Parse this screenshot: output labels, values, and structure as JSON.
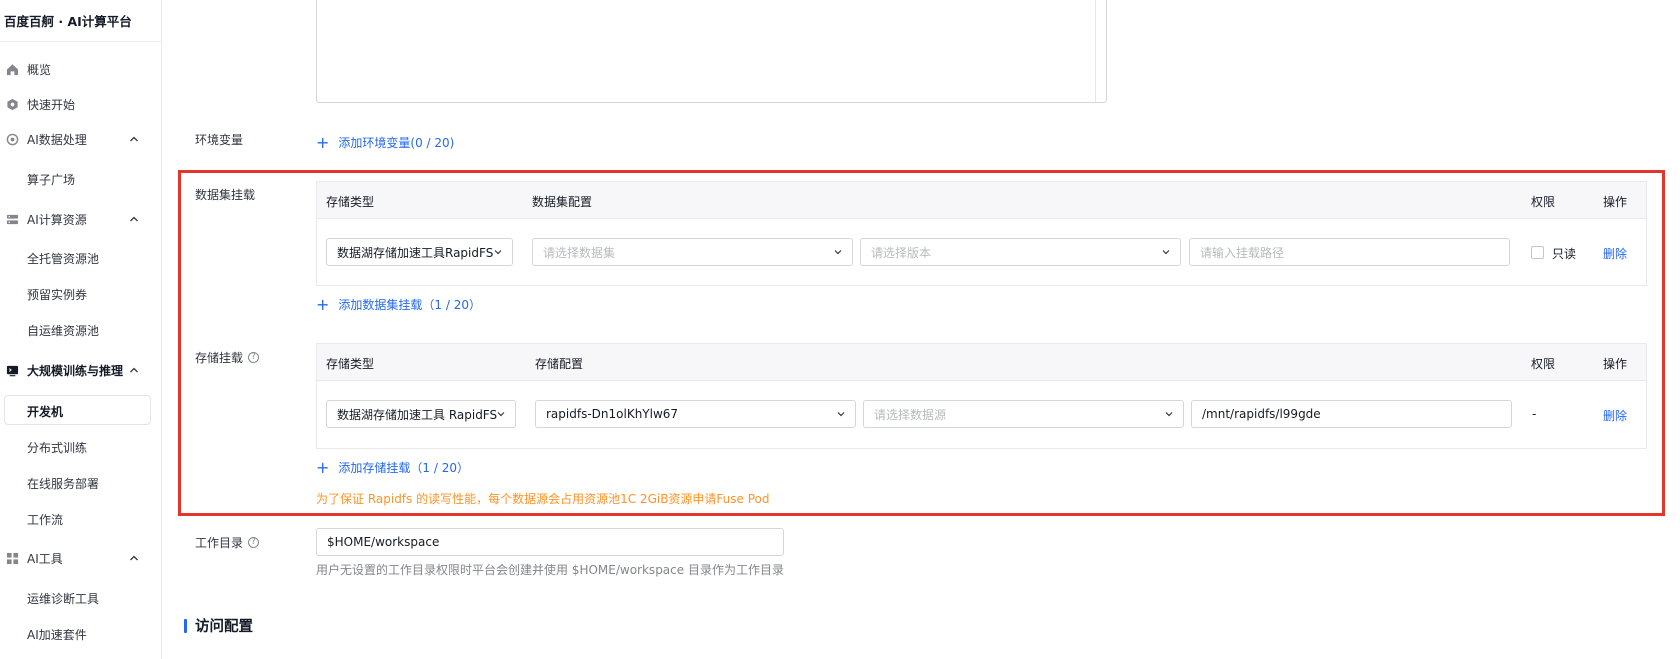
{
  "app": {
    "title": "百度百舸 · AI计算平台"
  },
  "sidebar": {
    "items": [
      {
        "label": "概览",
        "icon": "home-icon"
      },
      {
        "label": "快速开始",
        "icon": "rocket-icon"
      },
      {
        "label": "AI数据处理",
        "icon": "data-process-icon"
      },
      {
        "label": "算子广场"
      },
      {
        "label": "AI计算资源",
        "icon": "server-icon"
      },
      {
        "label": "全托管资源池"
      },
      {
        "label": "预留实例券"
      },
      {
        "label": "自运维资源池"
      },
      {
        "label": "大规模训练与推理",
        "icon": "terminal-icon"
      },
      {
        "label": "开发机"
      },
      {
        "label": "分布式训练"
      },
      {
        "label": "在线服务部署"
      },
      {
        "label": "工作流"
      },
      {
        "label": "AI工具",
        "icon": "grid-icon"
      },
      {
        "label": "运维诊断工具"
      },
      {
        "label": "AI加速套件"
      }
    ]
  },
  "env": {
    "label": "环境变量",
    "add_label": "添加环境变量(0 / 20)"
  },
  "dataset_mount": {
    "label": "数据集挂载",
    "columns": {
      "type": "存储类型",
      "config": "数据集配置",
      "perm": "权限",
      "ops": "操作"
    },
    "row": {
      "type_value": "数据湖存储加速工具RapidFS",
      "dataset_placeholder": "请选择数据集",
      "version_placeholder": "请选择版本",
      "path_placeholder": "请输入挂载路径",
      "readonly_label": "只读",
      "delete_label": "删除"
    },
    "add_label": "添加数据集挂载（1 / 20）"
  },
  "storage_mount": {
    "label": "存储挂载",
    "columns": {
      "type": "存储类型",
      "config": "存储配置",
      "perm": "权限",
      "ops": "操作"
    },
    "row": {
      "type_value": "数据湖存储加速工具 RapidFS",
      "instance_value": "rapidfs-Dn1olKhYlw67",
      "source_placeholder": "请选择数据源",
      "path_value": "/mnt/rapidfs/l99gde",
      "perm_value": "-",
      "delete_label": "删除"
    },
    "add_label": "添加存储挂载（1 / 20）",
    "warning": "为了保证 Rapidfs 的读写性能，每个数据源会占用资源池1C 2GiB资源申请Fuse Pod"
  },
  "workdir": {
    "label": "工作目录",
    "value": "$HOME/workspace",
    "hint": "用户无设置的工作目录权限时平台会创建并使用 $HOME/workspace 目录作为工作目录"
  },
  "access": {
    "title": "访问配置"
  },
  "colors": {
    "accent": "#2468f2",
    "warning": "#ff9326",
    "highlight": "#e33529"
  }
}
